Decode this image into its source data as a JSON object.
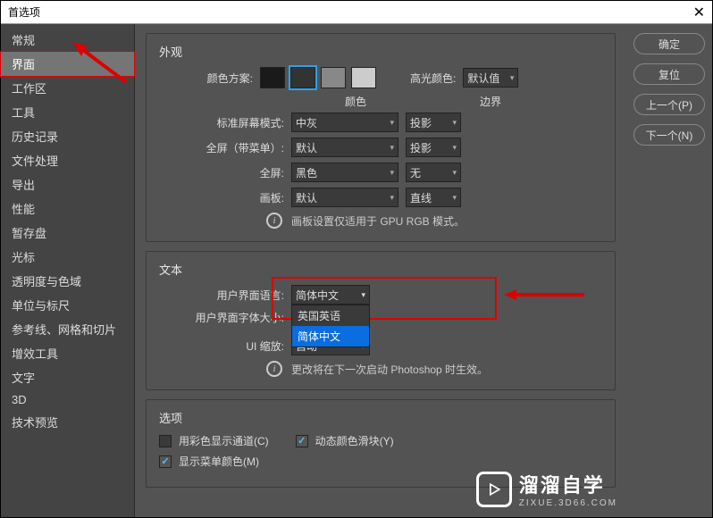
{
  "window": {
    "title": "首选项"
  },
  "sidebar": {
    "items": [
      {
        "label": "常规"
      },
      {
        "label": "界面"
      },
      {
        "label": "工作区"
      },
      {
        "label": "工具"
      },
      {
        "label": "历史记录"
      },
      {
        "label": "文件处理"
      },
      {
        "label": "导出"
      },
      {
        "label": "性能"
      },
      {
        "label": "暂存盘"
      },
      {
        "label": "光标"
      },
      {
        "label": "透明度与色域"
      },
      {
        "label": "单位与标尺"
      },
      {
        "label": "参考线、网格和切片"
      },
      {
        "label": "增效工具"
      },
      {
        "label": "文字"
      },
      {
        "label": "3D"
      },
      {
        "label": "技术预览"
      }
    ],
    "active_index": 1
  },
  "buttons": {
    "ok": "确定",
    "reset": "复位",
    "prev": "上一个(P)",
    "next": "下一个(N)"
  },
  "appearance": {
    "section": "外观",
    "color_scheme_label": "颜色方案:",
    "highlight_label": "高光颜色:",
    "highlight_value": "默认值",
    "col_color": "颜色",
    "col_border": "边界",
    "rows": {
      "std_screen": {
        "label": "标准屏幕模式:",
        "color": "中灰",
        "border": "投影"
      },
      "full_menu": {
        "label": "全屏（带菜单）:",
        "color": "默认",
        "border": "投影"
      },
      "full": {
        "label": "全屏:",
        "color": "黑色",
        "border": "无"
      },
      "artboard": {
        "label": "画板:",
        "color": "默认",
        "border": "直线"
      }
    },
    "info": "画板设置仅适用于 GPU RGB 模式。"
  },
  "text": {
    "section": "文本",
    "ui_lang_label": "用户界面语言:",
    "ui_lang_value": "简体中文",
    "lang_options": [
      "英国英语",
      "简体中文"
    ],
    "font_size_label": "用户界面字体大小:",
    "ui_zoom_label": "UI 缩放:",
    "ui_zoom_value": "自动",
    "info": "更改将在下一次启动 Photoshop 时生效。"
  },
  "options": {
    "section": "选项",
    "color_channels": {
      "label": "用彩色显示通道(C)",
      "checked": false
    },
    "dynamic_sliders": {
      "label": "动态颜色滑块(Y)",
      "checked": true
    },
    "menu_colors": {
      "label": "显示菜单颜色(M)",
      "checked": true
    }
  },
  "watermark": {
    "cn": "溜溜自学",
    "en": "ZIXUE.3D66.COM"
  }
}
